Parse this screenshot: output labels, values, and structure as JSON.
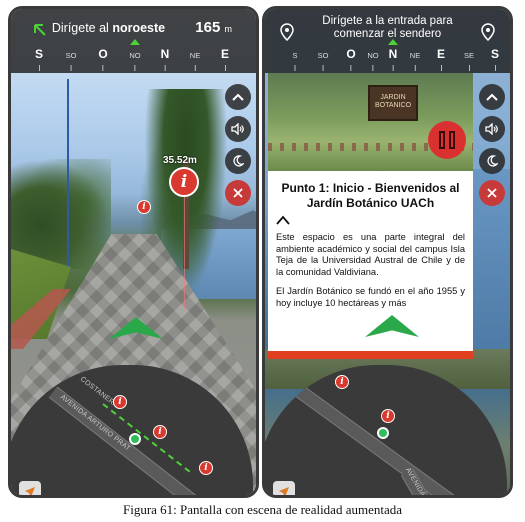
{
  "left_screen": {
    "instruction_prefix": "Dirígete al",
    "instruction_direction": "noroeste",
    "distance_value": "165",
    "distance_unit": "m",
    "compass": [
      {
        "label": "S",
        "minor": false
      },
      {
        "label": "SO",
        "minor": true
      },
      {
        "label": "O",
        "minor": false
      },
      {
        "label": "NO",
        "minor": true
      },
      {
        "label": "N",
        "minor": false
      },
      {
        "label": "NE",
        "minor": true
      },
      {
        "label": "E",
        "minor": false
      }
    ],
    "poi_distance": "35.52m",
    "streets": [
      "COSTANERA",
      "AVENIDA ARTURO PRAT"
    ]
  },
  "right_screen": {
    "instruction_line1": "Dirígete a la entrada para",
    "instruction_line2": "comenzar el sendero",
    "compass": [
      {
        "label": "S",
        "minor": true
      },
      {
        "label": "SO",
        "minor": true
      },
      {
        "label": "O",
        "minor": false
      },
      {
        "label": "NO",
        "minor": true
      },
      {
        "label": "N",
        "minor": false
      },
      {
        "label": "NE",
        "minor": true
      },
      {
        "label": "E",
        "minor": false
      },
      {
        "label": "SE",
        "minor": true
      },
      {
        "label": "S",
        "minor": false
      }
    ],
    "sign_text": "JARDIN BOTANICO",
    "card_title": "Punto 1: Inicio - Bienvenidos al Jardín Botánico UACh",
    "card_paragraph1": "Este espacio es una parte integral del ambiente académico y social del campus Isla Teja de la Universidad Austral de Chile y de la comunidad Valdiviana.",
    "card_paragraph2": "El Jardín Botánico se fundó en el año 1955 y hoy incluye 10 hectáreas y más",
    "street": "AVENIDA"
  },
  "caption": "Figura 61: Pantalla con escena de realidad aumentada",
  "colors": {
    "accent_green": "#4cd137",
    "poi_red": "#d9392f",
    "bar_dark": "#1e1e1e"
  },
  "icons": [
    "northwest-arrow-icon",
    "location-pin-icon",
    "chevron-up-icon",
    "volume-icon",
    "moon-icon",
    "close-icon",
    "info-icon",
    "pause-icon",
    "locate-arrow-icon"
  ]
}
